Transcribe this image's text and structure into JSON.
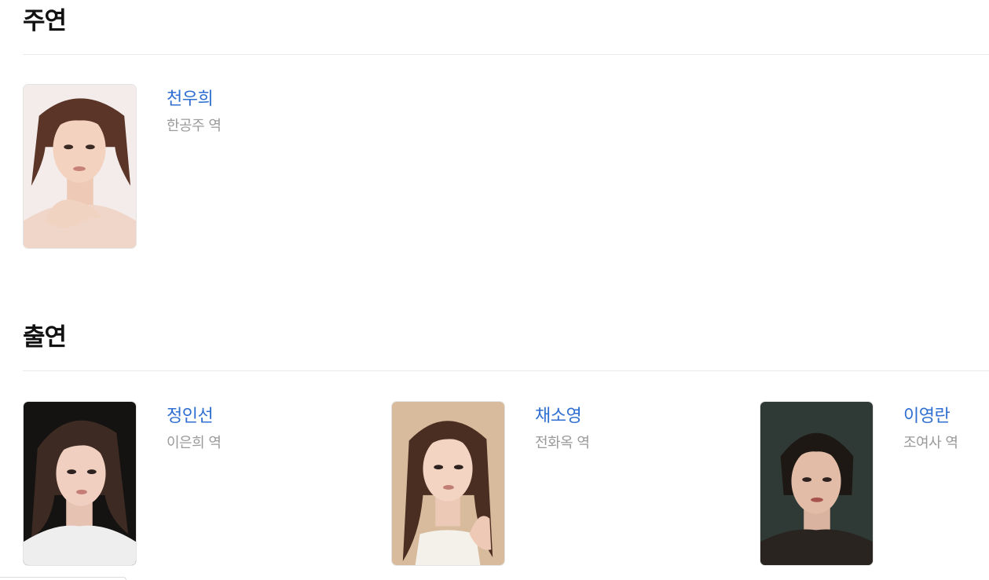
{
  "sections": {
    "lead": {
      "title": "주연",
      "cast": [
        {
          "name": "천우희",
          "role": "한공주 역"
        }
      ]
    },
    "supporting": {
      "title": "출연",
      "cast": [
        {
          "name": "정인선",
          "role": "이은희 역"
        },
        {
          "name": "채소영",
          "role": "전화옥 역"
        },
        {
          "name": "이영란",
          "role": "조여사 역"
        }
      ]
    }
  },
  "colors": {
    "name_link": "#2f6fd1",
    "role_text": "#9a9a9a",
    "heading": "#111111",
    "divider": "#e9e9e9"
  }
}
